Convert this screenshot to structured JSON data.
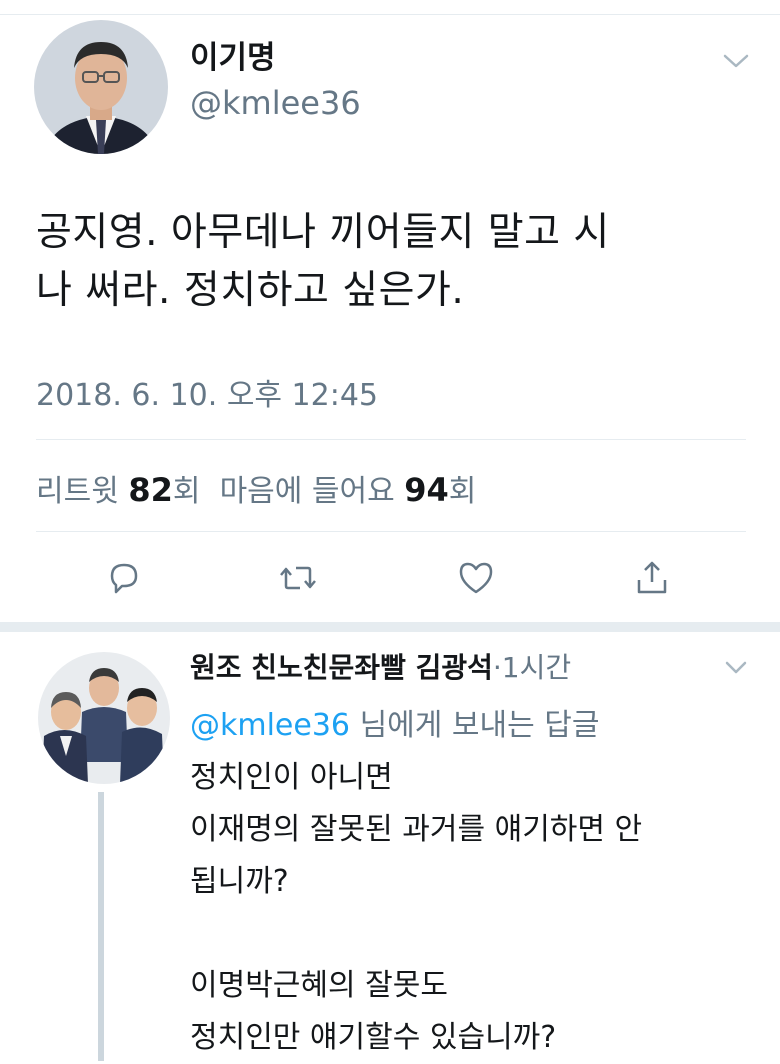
{
  "tweet": {
    "display_name": "이기명",
    "handle": "@kmlee36",
    "text_line1": "공지영. 아무데나 끼어들지 말고 시",
    "text_line2": "나 써라. 정치하고 싶은가.",
    "timestamp": "2018. 6. 10. 오후 12:45",
    "stats": {
      "retweet_label": "리트윗",
      "retweet_count": "82",
      "retweet_unit": "회",
      "like_label": "마음에 들어요",
      "like_count": "94",
      "like_unit": "회"
    },
    "actions": [
      "reply-icon",
      "retweet-icon",
      "like-icon",
      "share-icon"
    ]
  },
  "reply": {
    "display_name": "원조 친노친문좌빨  김광석",
    "meta": "·1시간",
    "replying_mention": "@kmlee36",
    "replying_suffix": " 님에게 보내는 답글",
    "lines": [
      "정치인이 아니면",
      "이재명의 잘못된 과거를 얘기하면 안",
      "됩니까?",
      "",
      "이명박근혜의 잘못도",
      "정치인만 얘기할수 있습니까?"
    ]
  },
  "colors": {
    "primary_text": "#14171a",
    "secondary_text": "#657786",
    "link": "#1da1f2",
    "divider": "#e6ecf0",
    "thread_line": "#ccd6dd"
  }
}
